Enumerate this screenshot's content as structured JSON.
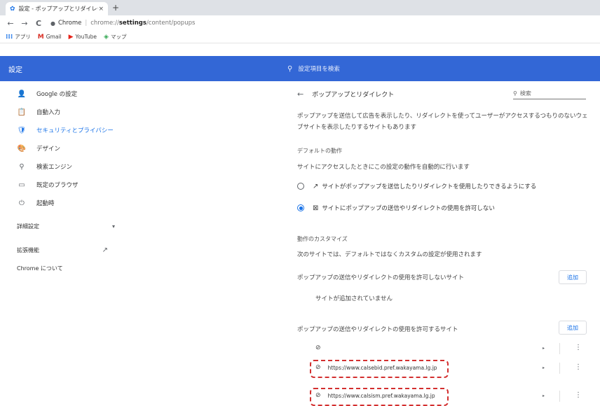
{
  "tab": {
    "title": "設定 - ポップアップとリダイレクト",
    "close": "×",
    "new_tab": "+"
  },
  "toolbar": {
    "back": "←",
    "forward": "→",
    "reload": "C",
    "chip": "Chrome",
    "url_bold": "settings",
    "url_prefix": "chrome://",
    "url_suffix": "/content/popups"
  },
  "bookmarks": [
    {
      "icon": "apps-icon",
      "label": "アプリ",
      "glyph": "⁞⁞⁞",
      "color": "#1a73e8"
    },
    {
      "icon": "gmail-icon",
      "label": "Gmail",
      "glyph": "M",
      "color": "#d93025"
    },
    {
      "icon": "youtube-icon",
      "label": "YouTube",
      "glyph": "▶",
      "color": "#e62117"
    },
    {
      "icon": "maps-icon",
      "label": "マップ",
      "glyph": "◈",
      "color": "#34a853"
    }
  ],
  "header": {
    "title": "設定",
    "search_placeholder": "設定項目を検索"
  },
  "sidebar": {
    "items": [
      {
        "name": "sidebar-item-google",
        "icon": "person-icon",
        "glyph": "👤",
        "label": "Google の設定",
        "active": false
      },
      {
        "name": "sidebar-item-autofill",
        "icon": "clipboard-icon",
        "glyph": "📋",
        "label": "自動入力",
        "active": false
      },
      {
        "name": "sidebar-item-security",
        "icon": "shield-icon",
        "glyph": "🛡",
        "label": "セキュリティとプライバシー",
        "active": true
      },
      {
        "name": "sidebar-item-design",
        "icon": "palette-icon",
        "glyph": "🎨",
        "label": "デザイン",
        "active": false
      },
      {
        "name": "sidebar-item-search-engine",
        "icon": "search-icon",
        "glyph": "⚲",
        "label": "検索エンジン",
        "active": false
      },
      {
        "name": "sidebar-item-default-browser",
        "icon": "browser-icon",
        "glyph": "▭",
        "label": "既定のブラウザ",
        "active": false
      },
      {
        "name": "sidebar-item-startup",
        "icon": "power-icon",
        "glyph": "⏻",
        "label": "起動時",
        "active": false
      }
    ],
    "advanced": "詳細設定",
    "advanced_chevron": "▾",
    "extensions": "拡張機能",
    "extensions_icon": "↗",
    "about": "Chrome について"
  },
  "content": {
    "page_title": "ポップアップとリダイレクト",
    "back_arrow": "←",
    "search_placeholder": "検索",
    "description_line1": "ポップアップを送信して広告を表示したり、リダイレクトを使ってユーザーがアクセスするつもりのないウェ",
    "description_line2": "ブサイトを表示したりするサイトもあります",
    "default_behavior_title": "デフォルトの動作",
    "default_behavior_desc": "サイトにアクセスしたときにこの設定の動作を自動的に行います",
    "option_allow": "サイトがポップアップを送信したりリダイレクトを使用したりできるようにする",
    "option_block": "サイトにポップアップの送信やリダイレクトの使用を許可しない",
    "option_allow_icon": "↗",
    "option_block_icon": "⊠",
    "customize_title": "動作のカスタマイズ",
    "customize_desc": "次のサイトでは、デフォルトではなくカスタムの設定が使用されます",
    "block_list_title": "ポップアップの送信やリダイレクトの使用を許可しないサイト",
    "block_list_empty": "サイトが追加されていません",
    "allow_list_title": "ポップアップの送信やリダイレクトの使用を許可するサイト",
    "add_label": "追加",
    "sites": [
      {
        "url": ""
      },
      {
        "url": "https://www.calsebid.pref.wakayama.lg.jp"
      },
      {
        "url": "https://www.calsism.pref.wakayama.lg.jp"
      }
    ],
    "site_arrow": "▸",
    "site_menu": "⋮",
    "site_icon": "⊘"
  },
  "colors": {
    "header": "#3367d6",
    "accent": "#1a73e8",
    "highlight": "#d32f2f"
  }
}
